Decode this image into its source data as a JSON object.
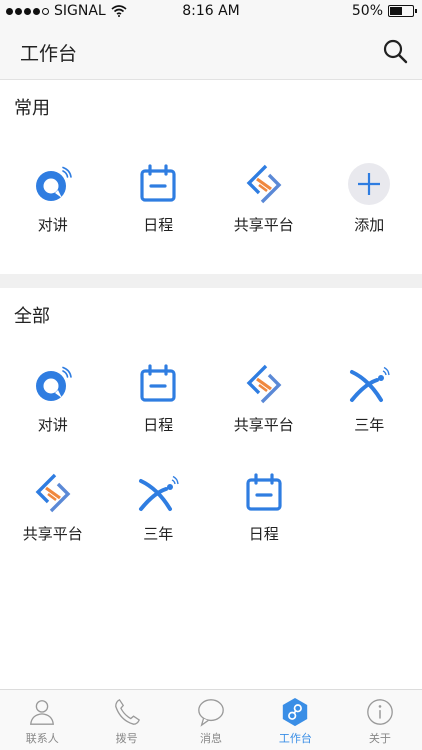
{
  "status_bar": {
    "carrier": "SIGNAL",
    "time": "8:16 AM",
    "battery": "50%",
    "battery_level": 0.5
  },
  "header": {
    "title": "工作台"
  },
  "common": {
    "title": "常用",
    "items": [
      {
        "label": "对讲",
        "icon": "talk-icon"
      },
      {
        "label": "日程",
        "icon": "calendar-icon"
      },
      {
        "label": "共享平台",
        "icon": "share-platform-icon"
      },
      {
        "label": "添加",
        "icon": "add-icon"
      }
    ]
  },
  "all": {
    "title": "全部",
    "items": [
      {
        "label": "对讲",
        "icon": "talk-icon"
      },
      {
        "label": "日程",
        "icon": "calendar-icon"
      },
      {
        "label": "共享平台",
        "icon": "share-platform-icon"
      },
      {
        "label": "三年",
        "icon": "sannian-icon"
      },
      {
        "label": "共享平台",
        "icon": "share-platform-icon"
      },
      {
        "label": "三年",
        "icon": "sannian-icon"
      },
      {
        "label": "日程",
        "icon": "calendar-icon"
      }
    ]
  },
  "tabs": [
    {
      "label": "联系人",
      "icon": "contacts-icon",
      "active": false
    },
    {
      "label": "拨号",
      "icon": "phone-icon",
      "active": false
    },
    {
      "label": "消息",
      "icon": "message-icon",
      "active": false
    },
    {
      "label": "工作台",
      "icon": "workbench-icon",
      "active": true
    },
    {
      "label": "关于",
      "icon": "info-icon",
      "active": false
    }
  ],
  "colors": {
    "accent": "#2f7de1",
    "orange": "#f0883e",
    "tab_active": "#3a8ee6",
    "tab_inactive": "#9a9a9a"
  }
}
